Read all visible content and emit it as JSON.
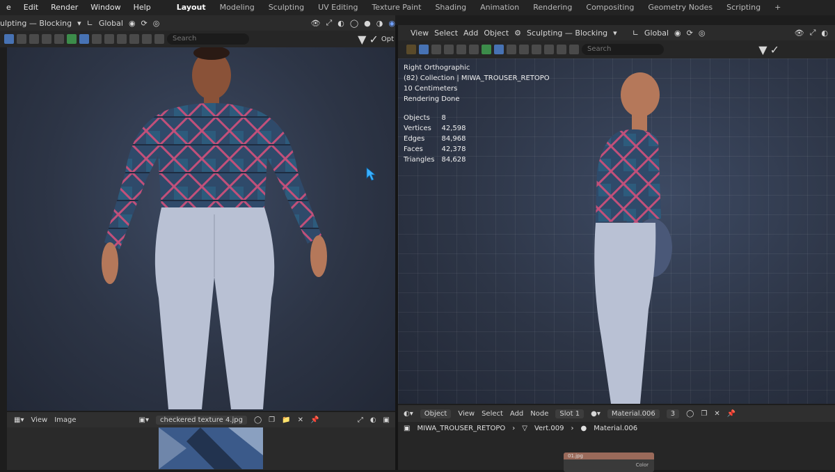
{
  "topbar": {
    "menu": [
      "e",
      "Edit",
      "Render",
      "Window",
      "Help"
    ],
    "workspaces": [
      "Layout",
      "Modeling",
      "Sculpting",
      "UV Editing",
      "Texture Paint",
      "Shading",
      "Animation",
      "Rendering",
      "Compositing",
      "Geometry Nodes",
      "Scripting",
      "+"
    ],
    "active_workspace": "Layout"
  },
  "left_header": {
    "mode": "ulpting — Blocking",
    "transform": "Global"
  },
  "left_tool": {
    "search_placeholder": "Search",
    "opt_label": "Opt"
  },
  "right_header": {
    "menus": [
      "View",
      "Select",
      "Add",
      "Object"
    ],
    "mode": "Sculpting — Blocking",
    "transform": "Global"
  },
  "right_tool": {
    "search_placeholder": "Search"
  },
  "right_viewport": {
    "info_lines": [
      "Right Orthographic",
      "(82) Collection | MIWA_TROUSER_RETOPO",
      "10 Centimeters",
      "Rendering Done"
    ],
    "stats": [
      {
        "label": "Objects",
        "value": "8"
      },
      {
        "label": "Vertices",
        "value": "42,598"
      },
      {
        "label": "Edges",
        "value": "84,968"
      },
      {
        "label": "Faces",
        "value": "42,378"
      },
      {
        "label": "Triangles",
        "value": "84,628"
      }
    ]
  },
  "image_editor": {
    "menus": [
      "View",
      "Image"
    ],
    "image_name": "checkered texture 4.jpg"
  },
  "node_editor": {
    "mode": "Object",
    "menus": [
      "View",
      "Select",
      "Add",
      "Node"
    ],
    "slot": "Slot 1",
    "material": "Material.006",
    "users": "3",
    "breadcrumbs": [
      "MIWA_TROUSER_RETOPO",
      "Vert.009",
      "Material.006"
    ],
    "node_title": "01.jpg",
    "node_socket": "Color"
  },
  "colors": {
    "accent": "#4772b3",
    "viewport": "#2d3546",
    "shirt": "#2f4a6a",
    "shirt_stripe": "#c2507a",
    "trousers": "#b9c1d4",
    "skin": "#b5785a"
  }
}
